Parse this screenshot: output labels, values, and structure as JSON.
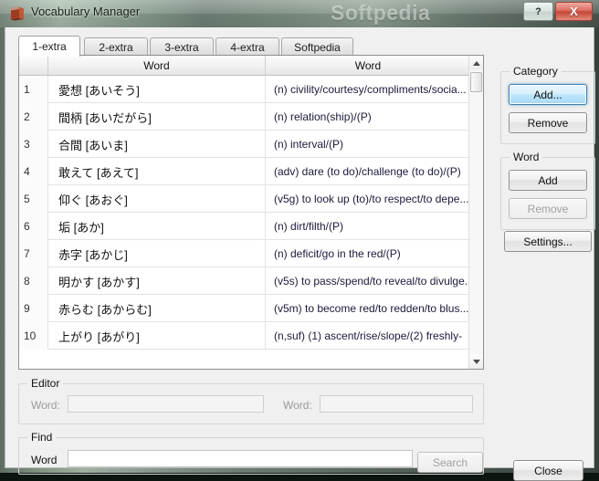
{
  "window": {
    "title": "Vocabulary Manager",
    "watermark": "Softpedia",
    "app_icon": "book-icon",
    "help_label": "?",
    "close_label": "X"
  },
  "tabs": [
    {
      "label": "1-extra",
      "active": true
    },
    {
      "label": "2-extra",
      "active": false
    },
    {
      "label": "3-extra",
      "active": false
    },
    {
      "label": "4-extra",
      "active": false
    },
    {
      "label": "Softpedia",
      "active": false
    }
  ],
  "grid": {
    "headers": {
      "num": "",
      "word1": "Word",
      "word2": "Word"
    },
    "rows": [
      {
        "num": "1",
        "word": "愛想 [あいそう]",
        "definition": "(n) civility/courtesy/compliments/socia..."
      },
      {
        "num": "2",
        "word": "間柄 [あいだがら]",
        "definition": "(n) relation(ship)/(P)"
      },
      {
        "num": "3",
        "word": "合間 [あいま]",
        "definition": "(n) interval/(P)"
      },
      {
        "num": "4",
        "word": "敢えて [あえて]",
        "definition": "(adv) dare (to do)/challenge (to do)/(P)"
      },
      {
        "num": "5",
        "word": "仰ぐ [あおぐ]",
        "definition": "(v5g) to look up (to)/to respect/to depe..."
      },
      {
        "num": "6",
        "word": "垢 [あか]",
        "definition": "(n) dirt/filth/(P)"
      },
      {
        "num": "7",
        "word": "赤字 [あかじ]",
        "definition": "(n) deficit/go in the red/(P)"
      },
      {
        "num": "8",
        "word": "明かす [あかす]",
        "definition": "(v5s) to pass/spend/to reveal/to divulge..."
      },
      {
        "num": "9",
        "word": "赤らむ [あからむ]",
        "definition": "(v5m) to become red/to redden/to blus..."
      },
      {
        "num": "10",
        "word": "上がり [あがり]",
        "definition": "(n,suf) (1) ascent/rise/slope/(2) freshly-"
      }
    ],
    "scrollbar": {
      "up_icon": "triangle-up-icon",
      "down_icon": "triangle-down-icon"
    }
  },
  "category_panel": {
    "title": "Category",
    "add_label": "Add...",
    "remove_label": "Remove"
  },
  "word_panel": {
    "title": "Word",
    "add_label": "Add",
    "remove_label": "Remove"
  },
  "settings_label": "Settings...",
  "editor": {
    "title": "Editor",
    "word1_label": "Word:",
    "word1_value": "",
    "word2_label": "Word:",
    "word2_value": ""
  },
  "find": {
    "title": "Find",
    "word_label": "Word",
    "word_value": "",
    "search_label": "Search"
  },
  "close_label": "Close"
}
